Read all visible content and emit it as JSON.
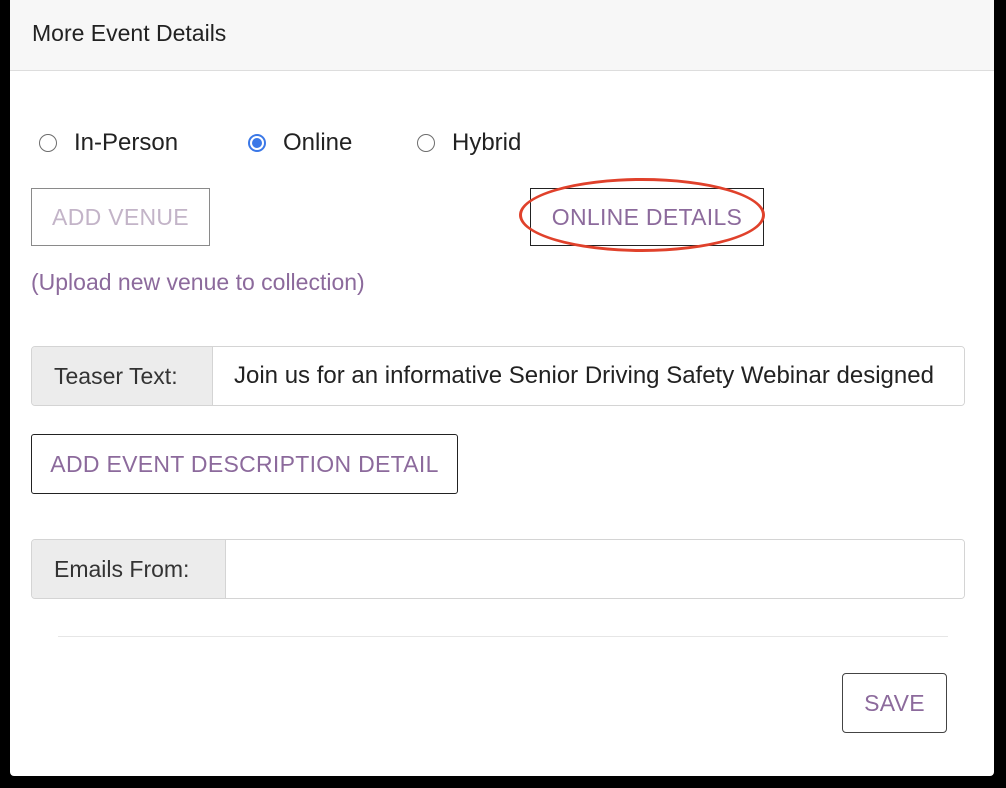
{
  "panel": {
    "title": "More Event Details"
  },
  "event_type": {
    "options": [
      {
        "label": "In-Person",
        "checked": false
      },
      {
        "label": "Online",
        "checked": true
      },
      {
        "label": "Hybrid",
        "checked": false
      }
    ],
    "selected": "Online"
  },
  "buttons": {
    "add_venue": "ADD VENUE",
    "online_details": "ONLINE DETAILS",
    "add_description": "ADD EVENT DESCRIPTION DETAIL",
    "save": "SAVE"
  },
  "upload_link": "(Upload new venue to collection)",
  "teaser": {
    "label": "Teaser Text:",
    "value": "Join us for an informative Senior Driving Safety Webinar designed"
  },
  "emails": {
    "label": "Emails From:",
    "value": ""
  },
  "colors": {
    "accent_purple": "#8c6a9c",
    "disabled_text": "#c3b4c8",
    "radio_blue": "#3b78e7",
    "highlight_red": "#e0412b"
  }
}
